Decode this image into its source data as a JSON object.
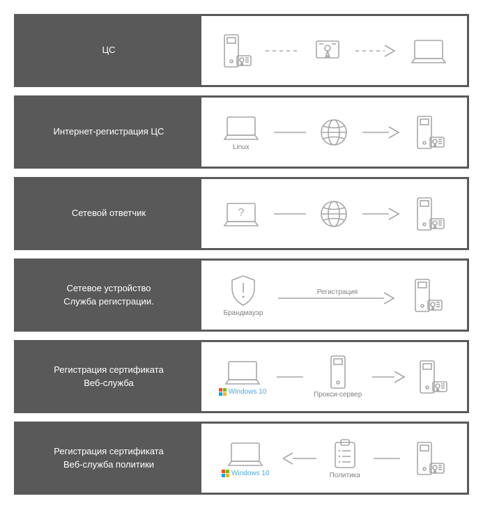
{
  "rows": [
    {
      "title1": "ЦС",
      "title2": ""
    },
    {
      "title1": "Интернет-регистрация ЦС",
      "title2": "",
      "caption_linux": "Linux"
    },
    {
      "title1": "Сетевой ответчик",
      "title2": ""
    },
    {
      "title1": "Сетевое устройство",
      "title2": "Служба регистрации.",
      "caption_firewall": "Брандмауэр",
      "edge_label": "Регистрация"
    },
    {
      "title1": "Регистрация сертификата",
      "title2": "Веб-служба",
      "caption_win": "Windows 10",
      "caption_proxy": "Прокси-сервер"
    },
    {
      "title1": "Регистрация сертификата",
      "title2": "Веб-служба политики",
      "caption_win": "Windows 10",
      "caption_policy": "Политика"
    }
  ]
}
